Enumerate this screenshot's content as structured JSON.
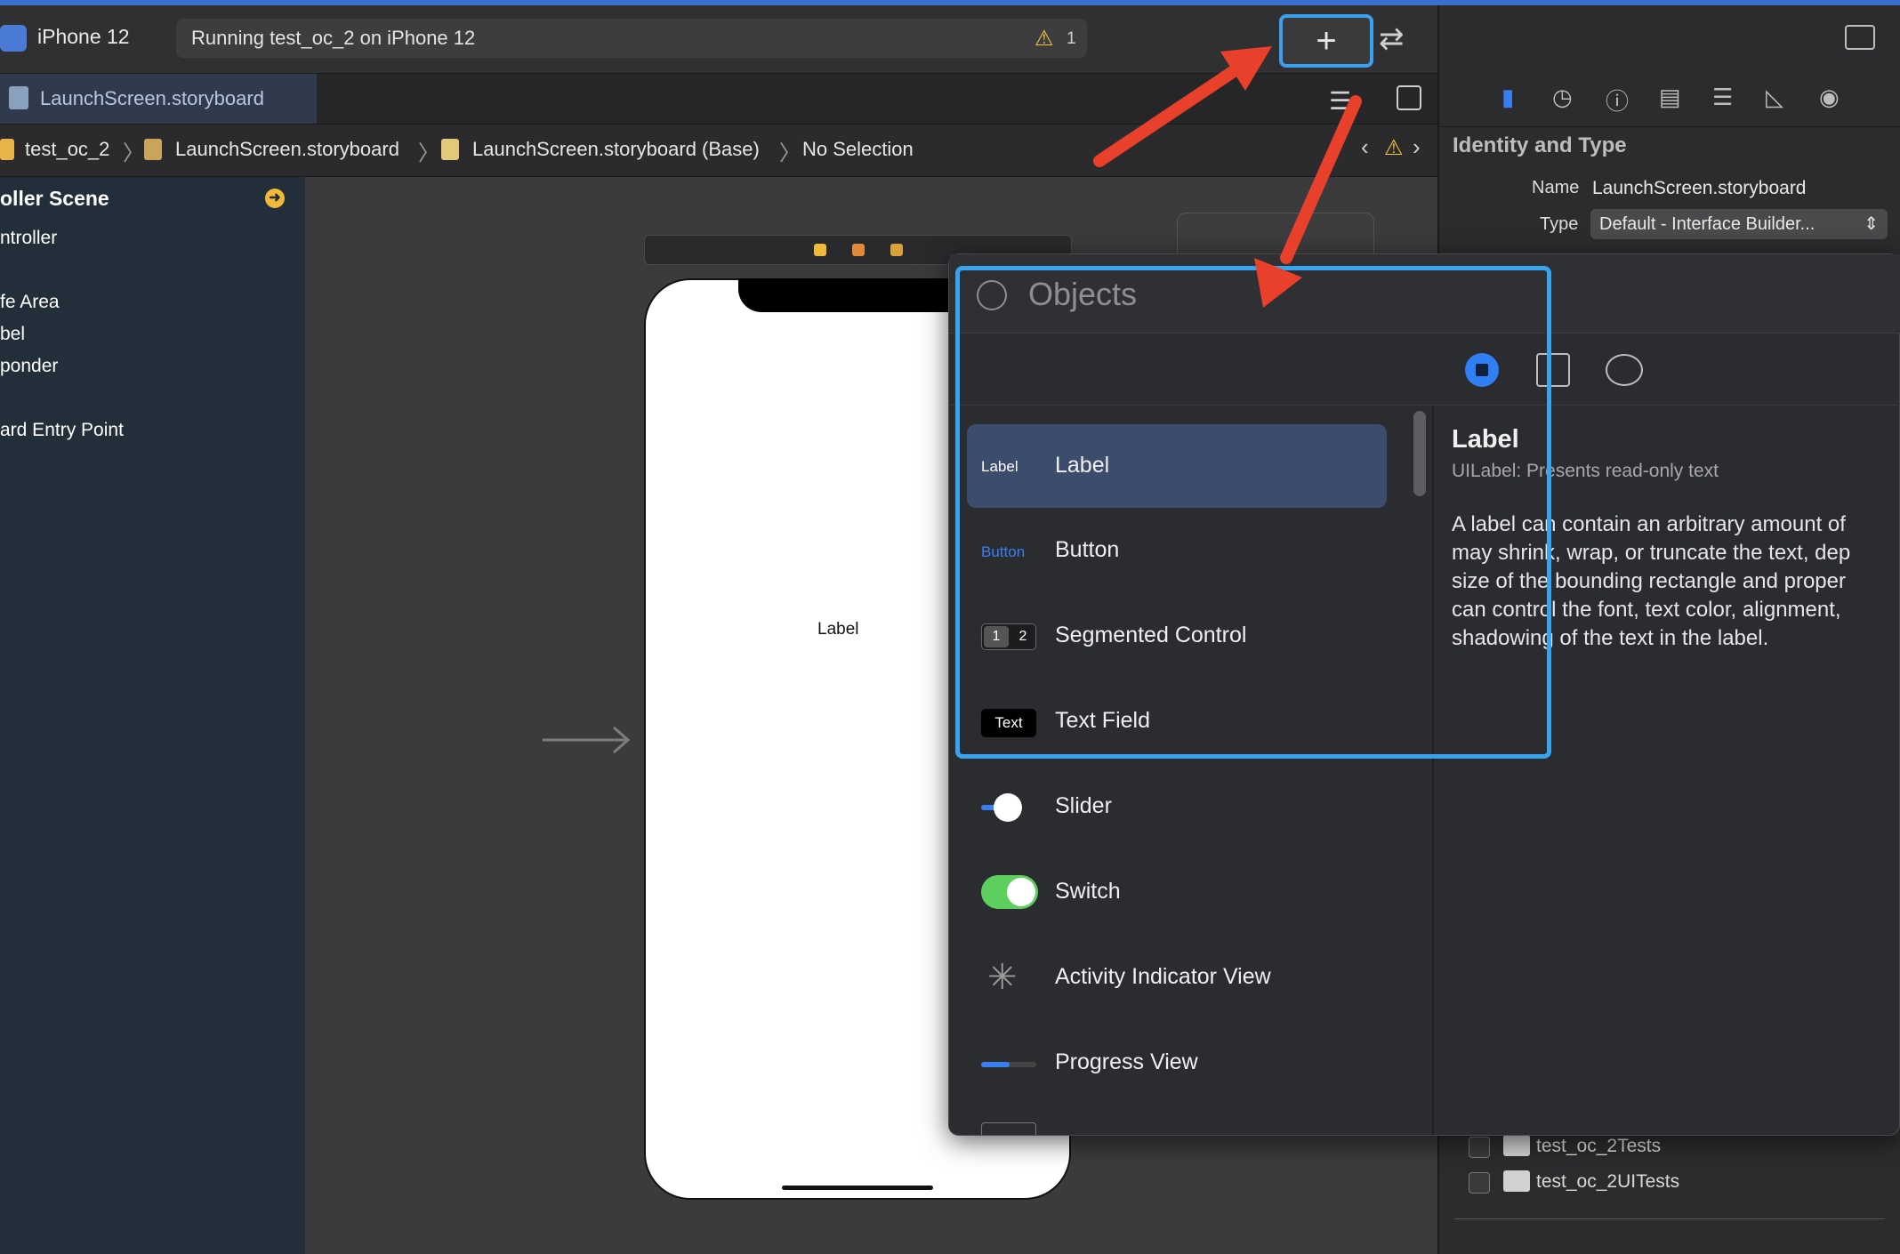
{
  "toolbar": {
    "scheme": "iPhone 12",
    "status": "Running test_oc_2 on iPhone 12",
    "warning_count": "1",
    "plus_label": "+"
  },
  "tab": {
    "label": "LaunchScreen.storyboard"
  },
  "breadcrumb": {
    "items": [
      "test_oc_2",
      "LaunchScreen.storyboard",
      "LaunchScreen.storyboard (Base)",
      "No Selection"
    ]
  },
  "outline": {
    "scene": "oller Scene",
    "items": [
      "ntroller",
      "fe Area",
      "bel",
      "ponder",
      "ard Entry Point"
    ]
  },
  "canvas": {
    "label_text": "Label"
  },
  "inspector": {
    "heading": "Identity and Type",
    "name_label": "Name",
    "name_value": "LaunchScreen.storyboard",
    "type_label": "Type",
    "type_value": "Default - Interface Builder...",
    "targets": [
      "test_oc_2Tests",
      "test_oc_2UITests"
    ]
  },
  "library": {
    "search_placeholder": "Objects",
    "items": [
      {
        "name": "Label",
        "thumb": "Label"
      },
      {
        "name": "Button",
        "thumb": "Button"
      },
      {
        "name": "Segmented Control",
        "thumb_a": "1",
        "thumb_b": "2"
      },
      {
        "name": "Text Field",
        "thumb": "Text"
      },
      {
        "name": "Slider"
      },
      {
        "name": "Switch"
      },
      {
        "name": "Activity Indicator View"
      },
      {
        "name": "Progress View"
      }
    ],
    "detail": {
      "title": "Label",
      "subtitle": "UILabel: Presents read-only text",
      "desc_lines": [
        "A label can contain an arbitrary amount of",
        "may shrink, wrap, or truncate the text, dep",
        "size of the bounding rectangle and proper",
        "can control the font, text color, alignment,",
        "shadowing of the text in the label."
      ]
    }
  },
  "colors": {
    "accent": "#2f7ff5",
    "highlight": "#3aa3f0",
    "arrow": "#e8402a",
    "switch_on": "#5ccf5e",
    "warning": "#f5c242"
  }
}
